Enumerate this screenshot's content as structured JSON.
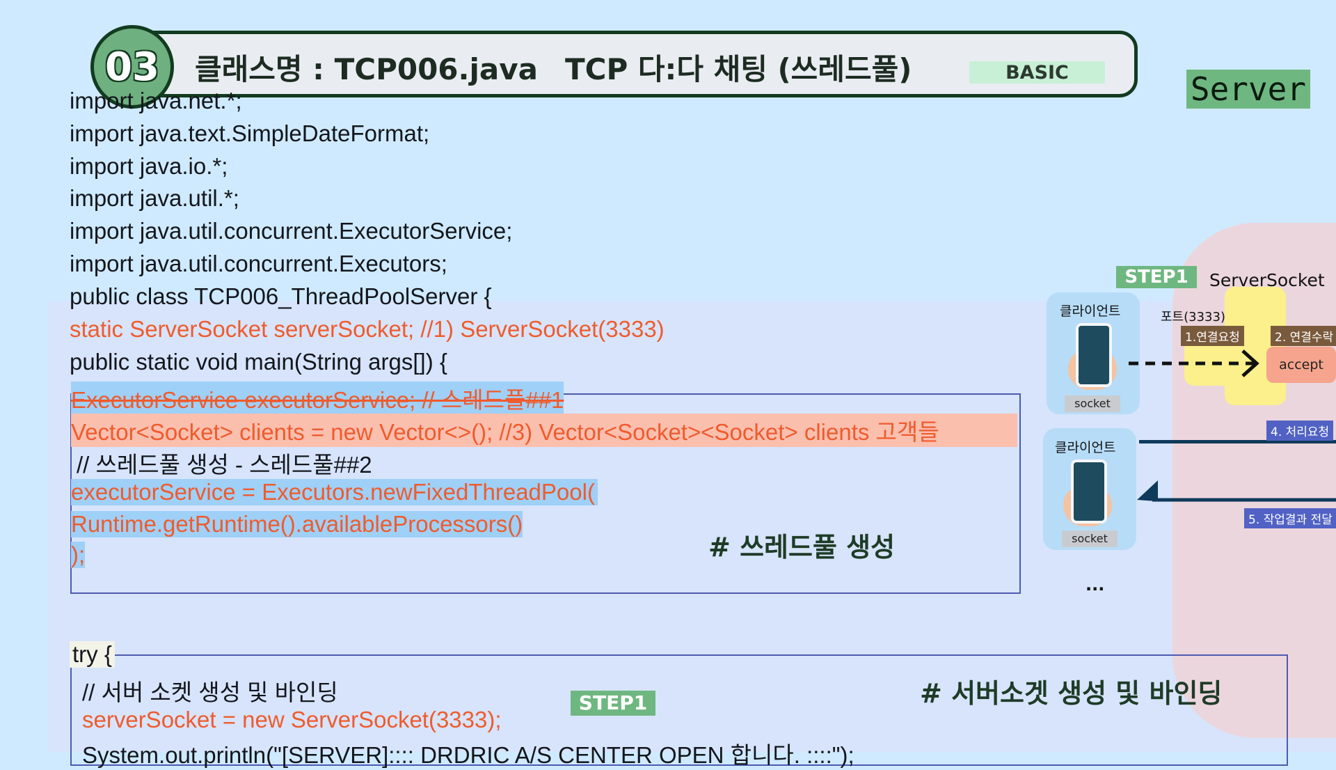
{
  "header": {
    "number": "03",
    "class_name": "클래스명 : TCP006.java",
    "subject": "TCP 다:다 채팅 (쓰레드풀)",
    "level": "BASIC"
  },
  "side_label": "Server",
  "code": {
    "l1": "import java.net.*;",
    "l2": "import java.text.SimpleDateFormat;",
    "l3": "import java.io.*;",
    "l4": "import java.util.*;",
    "l5": "import java.util.concurrent.ExecutorService;",
    "l6": "import java.util.concurrent.Executors;",
    "l7": "public class TCP006_ThreadPoolServer {",
    "l8": " static ServerSocket serverSocket; //1) ServerSocket(3333)",
    "l9": " public static void main(String args[]) {",
    "l10": " ExecutorService executorService; // 스레드풀##1",
    "l11": " Vector<Socket> clients = new Vector<>(); //3) Vector<Socket><Socket> clients 고객들",
    "l12": " // 쓰레드풀 생성 - 스레드풀##2",
    "l13": " executorService = Executors.newFixedThreadPool(",
    "l14": "  Runtime.getRuntime().availableProcessors()",
    "l15": " );",
    "l16": "try {",
    "l17": " // 서버 소켓 생성 및 바인딩",
    "l18": " serverSocket = new ServerSocket(3333);",
    "l19": " System.out.println(\"[SERVER]:::: DRDRIC A/S CENTER OPEN 합니다. ::::\");"
  },
  "annotations": {
    "thread_pool": "# 쓰레드풀 생성",
    "server_socket": "# 서버소겟 생성 및 바인딩",
    "step1_code": "STEP1"
  },
  "diagram": {
    "step1": "STEP1",
    "server_socket": "ServerSocket",
    "client1": "클라이언트",
    "client2": "클라이언트",
    "socket1": "socket",
    "socket2": "socket",
    "port": "포트(3333)",
    "req1": "1.연결요청",
    "req2": "2. 연결수락",
    "accept": "accept",
    "req4": "4. 처리요청",
    "req5": "5. 작업결과 전달",
    "more": "..."
  },
  "colors": {
    "background": "#cfeaff",
    "accent_green": "#6fb781",
    "code_red": "#ef5b2d",
    "highlight_blue": "#9fd0f7",
    "highlight_pink": "#fbbfae"
  }
}
